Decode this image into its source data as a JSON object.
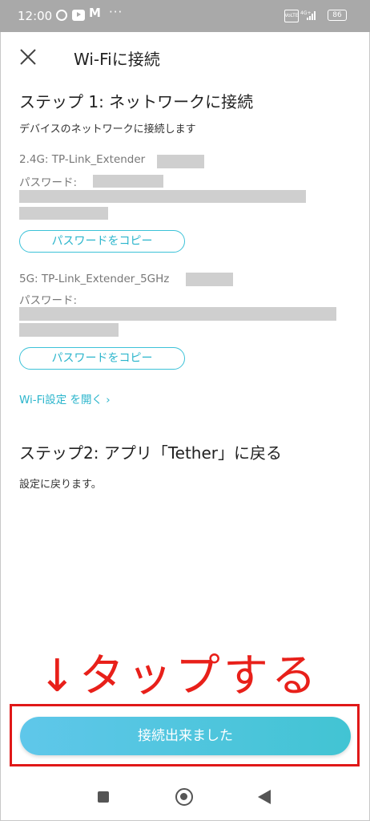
{
  "status_bar": {
    "time": "12:00",
    "mc": "M",
    "more": "···",
    "volte": "VoLTE",
    "network": "4G+",
    "battery": "86"
  },
  "header": {
    "title": "Wi-Fiに接続"
  },
  "step1": {
    "heading": "ステップ 1: ネットワークに接続",
    "description": "デバイスのネットワークに接続します",
    "network_24": {
      "ssid_label": "2.4G: TP-Link_Extender",
      "password_label": "パスワード:",
      "copy_button": "パスワードをコピー"
    },
    "network_5": {
      "ssid_label": "5G: TP-Link_Extender_5GHz",
      "password_label": "パスワード:",
      "copy_button": "パスワードをコピー"
    },
    "open_wifi_link": "Wi-Fi設定 を開く ›"
  },
  "step2": {
    "heading": "ステップ2: アプリ「Tether」に戻る",
    "description": "設定に戻ります。"
  },
  "annotation": {
    "text": "↓タップする"
  },
  "primary_button": {
    "label": "接続出来ました"
  },
  "colors": {
    "accent": "#2bb5cc",
    "annotation": "#e8201a",
    "status_bar": "#a9a9a9"
  }
}
